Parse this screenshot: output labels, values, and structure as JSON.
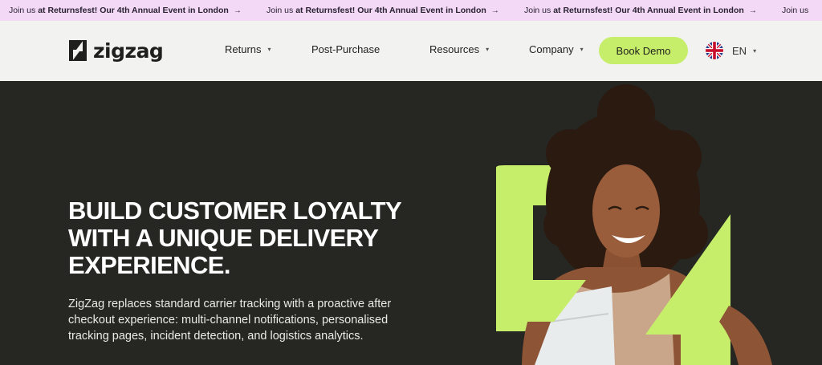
{
  "announcement": {
    "items": [
      {
        "prefix": "Join us ",
        "bold": "at Returnsfest! Our 4th Annual Event in London",
        "arrow": "→"
      },
      {
        "prefix": "Join us ",
        "bold": "at Returnsfest! Our 4th Annual Event in London",
        "arrow": "→"
      },
      {
        "prefix": "Join us ",
        "bold": "at Returnsfest! Our 4th Annual Event in London",
        "arrow": "→"
      },
      {
        "prefix": "Join us",
        "bold": "",
        "arrow": ""
      }
    ]
  },
  "header": {
    "logo_text": "zigzag",
    "nav": [
      {
        "label": "Returns",
        "has_caret": true,
        "caret": "▾"
      },
      {
        "label": "Post-Purchase",
        "has_caret": false,
        "caret": ""
      },
      {
        "label": "Resources",
        "has_caret": true,
        "caret": "▾"
      },
      {
        "label": "Company",
        "has_caret": true,
        "caret": "▾"
      }
    ],
    "cta_label": "Book Demo",
    "language": {
      "label": "EN",
      "caret": "▾",
      "flag": "uk-flag-icon"
    }
  },
  "hero": {
    "title_lines": [
      "BUILD CUSTOMER LOYALTY",
      "WITH A UNIQUE DELIVERY",
      "EXPERIENCE."
    ],
    "subtitle": "ZigZag replaces standard carrier tracking with a proactive after checkout experience: multi-channel notifications, personalised tracking pages, incident detection, and logistics analytics.",
    "image": "smiling-woman-holding-parcel-with-zigzag-mark"
  },
  "colors": {
    "announcement_bg": "#f3d9f6",
    "header_bg": "#f2f2f0",
    "hero_bg": "#262622",
    "accent_lime": "#c6ee6b",
    "brand_dark": "#1f1f1d"
  }
}
